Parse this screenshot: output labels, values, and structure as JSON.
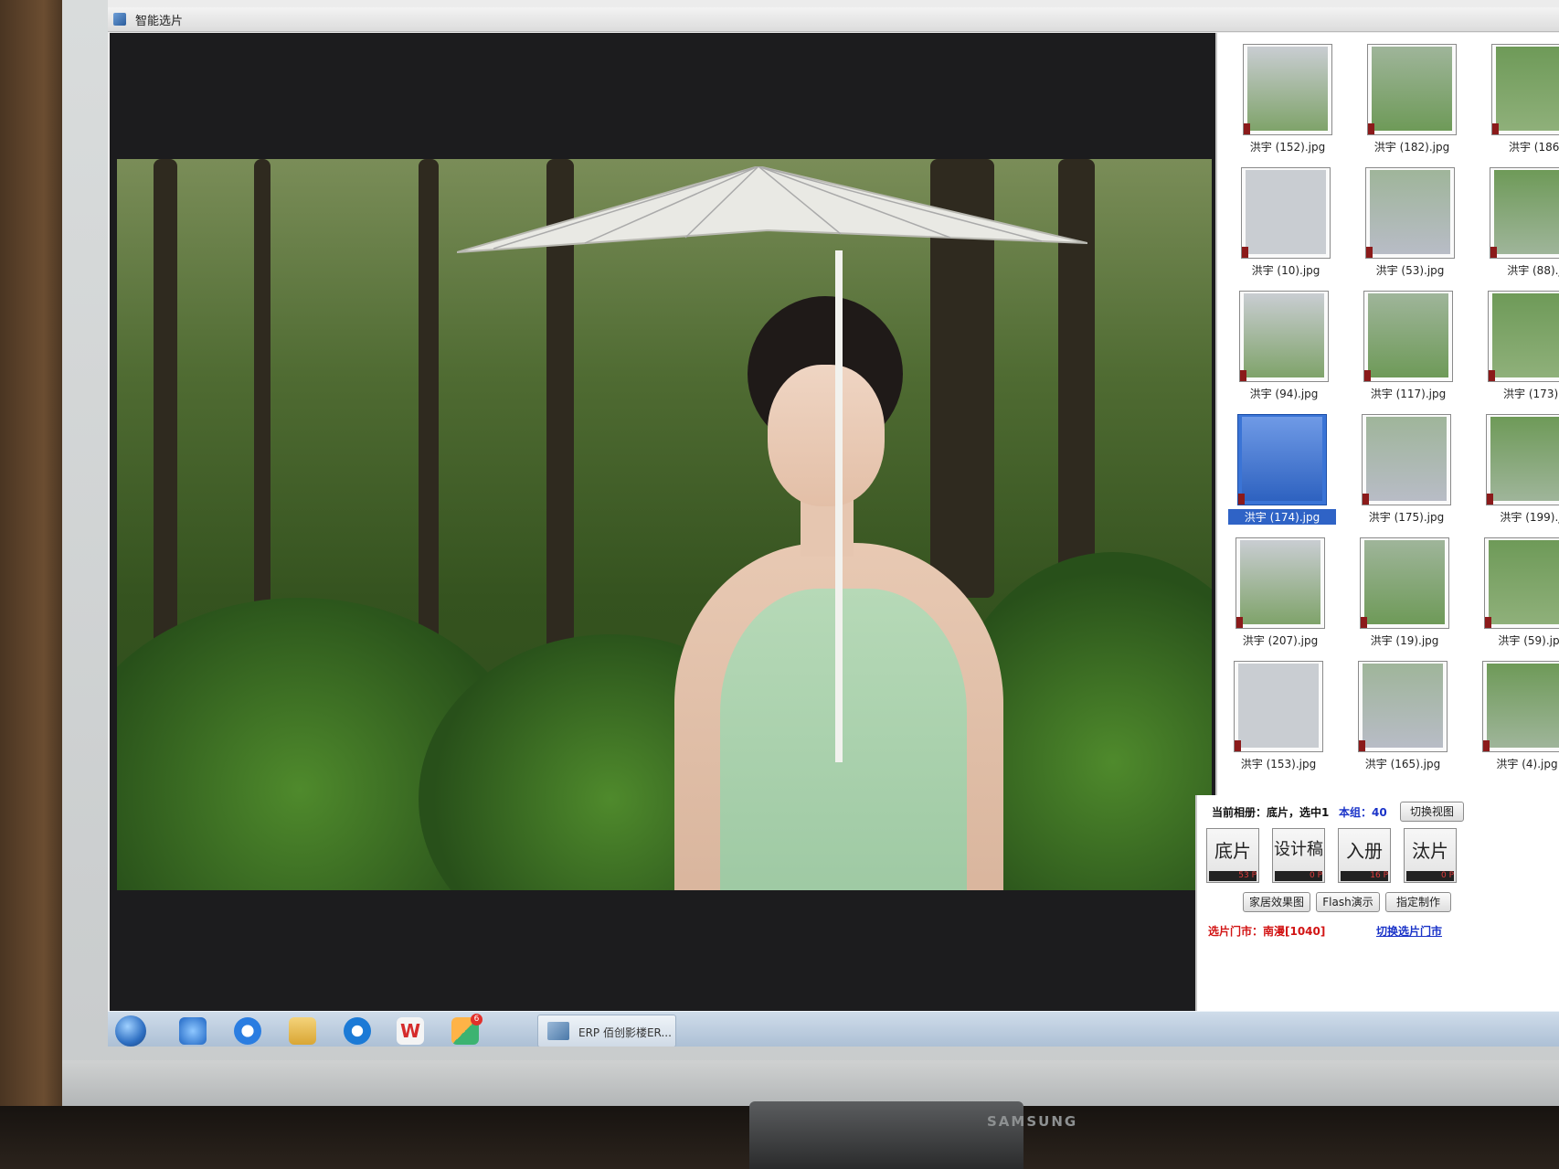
{
  "window": {
    "title": "智能选片"
  },
  "thumbnails": [
    {
      "label": "洪宇 (152).jpg",
      "selected": false
    },
    {
      "label": "洪宇 (182).jpg",
      "selected": false
    },
    {
      "label": "洪宇 (186)",
      "selected": false
    },
    {
      "label": "洪宇 (10).jpg",
      "selected": false
    },
    {
      "label": "洪宇 (53).jpg",
      "selected": false
    },
    {
      "label": "洪宇 (88).j",
      "selected": false
    },
    {
      "label": "洪宇 (94).jpg",
      "selected": false
    },
    {
      "label": "洪宇 (117).jpg",
      "selected": false
    },
    {
      "label": "洪宇 (173).",
      "selected": false
    },
    {
      "label": "洪宇 (174).jpg",
      "selected": true
    },
    {
      "label": "洪宇 (175).jpg",
      "selected": false
    },
    {
      "label": "洪宇 (199).j",
      "selected": false
    },
    {
      "label": "洪宇 (207).jpg",
      "selected": false
    },
    {
      "label": "洪宇 (19).jpg",
      "selected": false
    },
    {
      "label": "洪宇 (59).jp",
      "selected": false
    },
    {
      "label": "洪宇 (153).jpg",
      "selected": false
    },
    {
      "label": "洪宇 (165).jpg",
      "selected": false
    },
    {
      "label": "洪宇 (4).jpg",
      "selected": false
    }
  ],
  "panel": {
    "current_album": "当前相册：底片，选中1",
    "group_count": "本组：40",
    "switch_view": "切换视图",
    "categories": [
      {
        "label": "底片",
        "count": "53 P"
      },
      {
        "label": "设计稿",
        "count": "0 P"
      },
      {
        "label": "入册",
        "count": "16 P"
      },
      {
        "label": "汰片",
        "count": "0 P"
      }
    ],
    "actions": [
      "家居效果图",
      "Flash演示",
      "指定制作"
    ],
    "store": "选片门市：南漫[1040]",
    "switch_store": "切换选片门市"
  },
  "taskbar": {
    "task_label": "ERP 佰创影楼ER...",
    "wps_badge": "6"
  },
  "monitor": {
    "brand": "SAMSUNG"
  },
  "colors": {
    "selection": "#2f63c6",
    "store_text": "#d21414",
    "link_text": "#1a33c8"
  }
}
